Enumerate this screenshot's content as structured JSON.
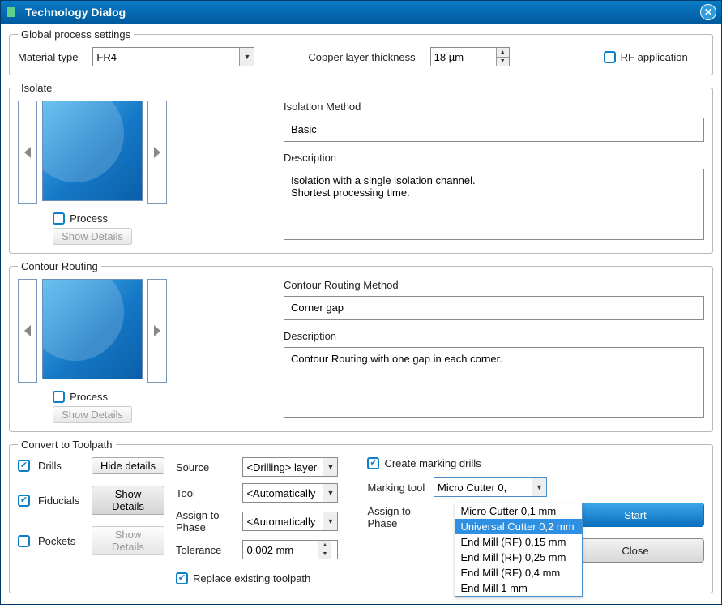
{
  "window": {
    "title": "Technology Dialog"
  },
  "global": {
    "legend": "Global process settings",
    "material_label": "Material type",
    "material_value": "FR4",
    "thickness_label": "Copper layer thickness",
    "thickness_value": "18 µm",
    "rf_label": "RF application",
    "rf_checked": false
  },
  "isolate": {
    "legend": "Isolate",
    "method_label": "Isolation Method",
    "method_value": "Basic",
    "desc_label": "Description",
    "desc_value": "Isolation with a single isolation channel.\nShortest processing time.",
    "process_label": "Process",
    "process_checked": false,
    "show_details_label": "Show Details"
  },
  "contour": {
    "legend": "Contour Routing",
    "method_label": "Contour Routing Method",
    "method_value": "Corner gap",
    "desc_label": "Description",
    "desc_value": "Contour Routing with one gap in each corner.",
    "process_label": "Process",
    "process_checked": false,
    "show_details_label": "Show Details"
  },
  "convert": {
    "legend": "Convert to Toolpath",
    "drills_label": "Drills",
    "drills_checked": true,
    "drills_btn": "Hide details",
    "fiducials_label": "Fiducials",
    "fiducials_checked": true,
    "fiducials_btn": "Show Details",
    "pockets_label": "Pockets",
    "pockets_checked": false,
    "pockets_btn": "Show Details",
    "source_label": "Source",
    "source_value": "<Drilling> layer",
    "tool_label": "Tool",
    "tool_value": "<Automatically",
    "phase_label": "Assign to Phase",
    "phase_value": "<Automatically",
    "tolerance_label": "Tolerance",
    "tolerance_value": "0.002 mm",
    "replace_label": "Replace existing toolpath",
    "replace_checked": true,
    "create_marking_label": "Create marking drills",
    "create_marking_checked": true,
    "marking_tool_label": "Marking tool",
    "marking_tool_value": "Micro Cutter 0,",
    "marking_phase_label": "Assign to Phase",
    "options": [
      "Micro Cutter 0,1 mm",
      "Universal Cutter 0,2 mm",
      "End Mill (RF) 0,15 mm",
      "End Mill (RF) 0,25 mm",
      "End Mill (RF) 0,4 mm",
      "End Mill 1 mm"
    ],
    "selected_option_index": 1
  },
  "buttons": {
    "start": "Start",
    "close": "Close"
  }
}
